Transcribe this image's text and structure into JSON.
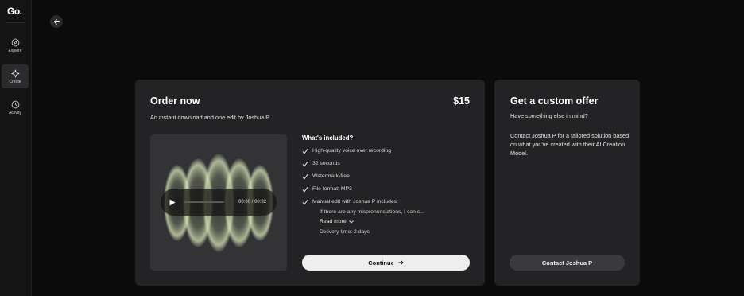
{
  "app": {
    "logo": "Go."
  },
  "sidebar": {
    "items": [
      {
        "label": "Explore",
        "icon": "compass-icon"
      },
      {
        "label": "Create",
        "icon": "sparkle-icon",
        "active": true
      },
      {
        "label": "Activity",
        "icon": "clock-icon"
      }
    ]
  },
  "order": {
    "title": "Order now",
    "price": "$15",
    "subtitle": "An instant download and one edit by Joshua P.",
    "player": {
      "time": "00:00 / 00:32"
    },
    "included_title": "What's included?",
    "included": [
      "High-quality voice over recording",
      "32 seconds",
      "Watermark-free",
      "File format: MP3",
      "Manual edit with Joshua P includes:"
    ],
    "edit_detail": "If there are any mispronunciations, I can c...",
    "read_more": "Read more",
    "delivery": "Delivery time: 2 days",
    "continue_label": "Continue"
  },
  "custom": {
    "title": "Get a custom offer",
    "subtitle": "Have something else in mind?",
    "description": "Contact Joshua P for a tailored solution based on what you've created with their AI Creation Model.",
    "contact_label": "Contact Joshua P"
  }
}
